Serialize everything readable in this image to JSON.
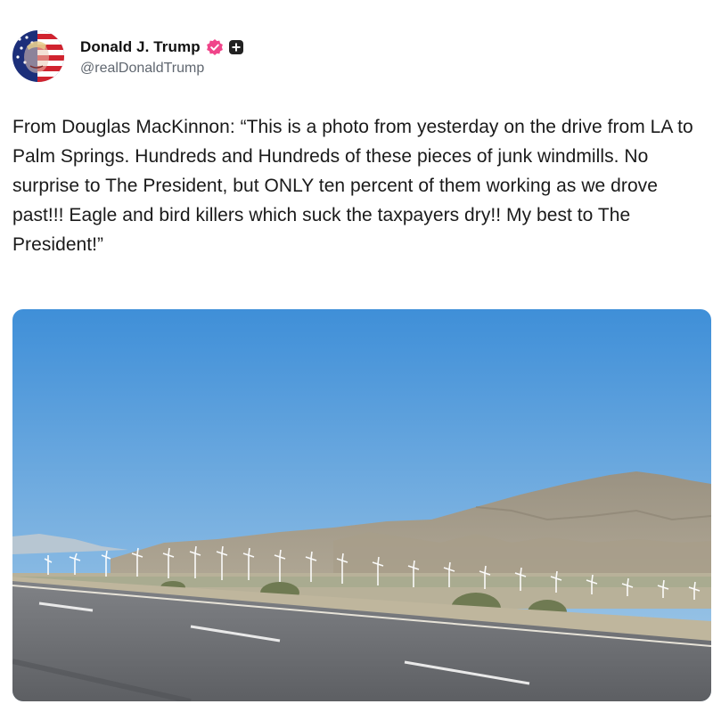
{
  "author": {
    "display_name": "Donald J. Trump",
    "handle": "@realDonaldTrump",
    "verified_badge_icon": "verified-badge-icon",
    "verified_color": "#f0458a",
    "plus_badge_icon": "plus-badge-icon"
  },
  "post": {
    "text": "From Douglas MacKinnon: “This is a photo from yesterday on the drive from LA to Palm Springs. Hundreds and Hundreds of these pieces of junk windmills. No surprise to The President, but ONLY ten percent of them working as we drove past!!! Eagle and bird killers which suck the taxpayers dry!! My best to The President!”"
  },
  "media": {
    "type": "photo",
    "subject": "wind-turbine-field-highway-photo"
  },
  "colors": {
    "sky_top": "#3f8fd8",
    "sky_bottom": "#aacde8",
    "mountain": "#a29a8a",
    "road": "#6f7175"
  }
}
